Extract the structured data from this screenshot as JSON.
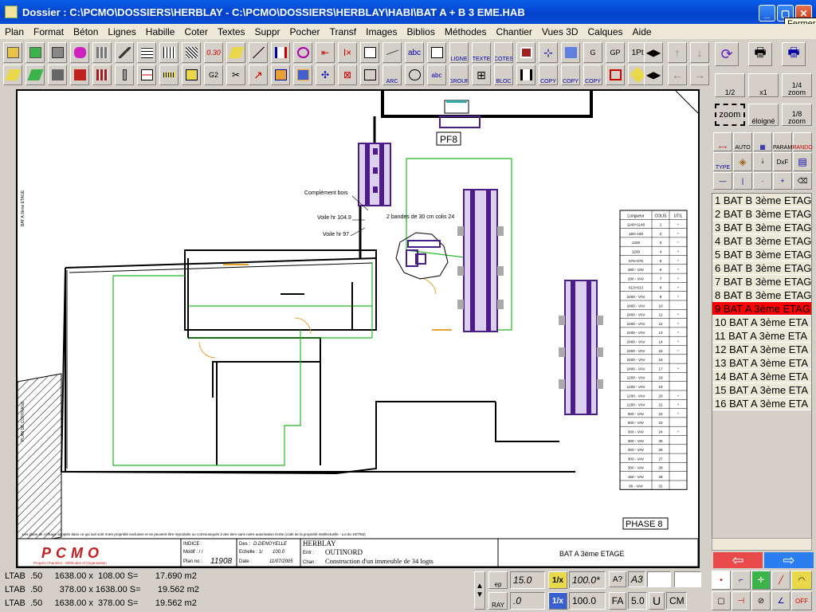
{
  "window": {
    "title": "Dossier : C:\\PCMO\\DOSSIERS\\HERBLAY - C:\\PCMO\\DOSSIERS\\HERBLAY\\HABI\\BAT A + B 3 EME.HAB",
    "tooltip": "Fermer"
  },
  "menu": [
    "Plan",
    "Format",
    "Béton",
    "Lignes",
    "Habille",
    "Coter",
    "Textes",
    "Suppr",
    "Pocher",
    "Transf",
    "Images",
    "Biblios",
    "Méthodes",
    "Chantier",
    "Vues 3D",
    "Calques",
    "Aide"
  ],
  "toolbar_labels": {
    "t030": "0.30",
    "ligne": "LIGNE",
    "texte": "TEXTE",
    "cotes": "COTES",
    "one_pt": "1Pt",
    "arc": "ARC",
    "group": "GROUP",
    "bloc": "BLOC",
    "copy1": "COPY",
    "copy2": "COPY",
    "copy3": "COPY",
    "g2": "G2",
    "gp": "GP",
    "abc": "abc"
  },
  "right_tools": {
    "half": "1/2",
    "x1": "x1",
    "quarter": "1/4",
    "zoom_lbl": "zoom",
    "zoom": "zoom",
    "eloigne": "éloigné",
    "eighth": "1/8",
    "auto": "AUTO",
    "param": "PARAM",
    "rando": "RANDO",
    "type": "TYPE",
    "dxf": "DxF",
    "dwg": "DWG",
    "abc": "abc"
  },
  "layers": [
    "1 BAT B 3ème ETAG",
    "2 BAT B 3ème ETAG",
    "3 BAT B 3ème ETAG",
    "4 BAT B 3ème ETAG",
    "5 BAT B 3ème ETAG",
    "6 BAT B 3ème ETAG",
    "7 BAT B 3ème ETAG",
    "8 BAT B 3ème ETAG",
    "9 BAT A 3ème ETAG",
    "10 BAT A 3ème ETA",
    "11 BAT A 3ème ETA",
    "12 BAT A 3ème ETA",
    "13 BAT A 3ème ETA",
    "14 BAT A 3ème ETA",
    "15 BAT A 3ème ETA",
    "16 BAT A 3ème ETA"
  ],
  "selected_layer_index": 8,
  "drawing": {
    "pf_label": "PF8",
    "annotations": {
      "complement": "Complément bois",
      "voile1": "Voile hr 104.9",
      "voile2": "Voile hr 97",
      "bandes": "2 bandes de 30 cm colis 24"
    },
    "phase": "PHASE 8",
    "table": {
      "headers": [
        "Longueur",
        "COLIS",
        "UTIL"
      ],
      "rows": [
        [
          "1140+1140",
          "1",
          "*"
        ],
        [
          "160+160",
          "2",
          "*"
        ],
        [
          "1200",
          "3",
          "*"
        ],
        [
          "1200",
          "4",
          "*"
        ],
        [
          "675+675",
          "5",
          "*"
        ],
        [
          "280 - VAV",
          "6",
          "*"
        ],
        [
          "280 - VAV",
          "7",
          "*"
        ],
        [
          "613+613",
          "8",
          "*"
        ],
        [
          "2400 - VAV",
          "9",
          "*"
        ],
        [
          "2400 - VAV",
          "10",
          ""
        ],
        [
          "2400 - VAV",
          "11",
          "*"
        ],
        [
          "2400 - VAV",
          "12",
          "*"
        ],
        [
          "2400 - VAV",
          "13",
          "*"
        ],
        [
          "2400 - VAV",
          "14",
          "*"
        ],
        [
          "2400 - VAV",
          "15",
          "*"
        ],
        [
          "2400 - VAV",
          "16",
          ""
        ],
        [
          "2400 - VAV",
          "17",
          "*"
        ],
        [
          "1200 - VAV",
          "18",
          ""
        ],
        [
          "1200 - VAV",
          "19",
          ""
        ],
        [
          "1200 - VAV",
          "20",
          "*"
        ],
        [
          "1200 - VAV",
          "21",
          "*"
        ],
        [
          "600 - VAV",
          "22",
          "*"
        ],
        [
          "600 - VAV",
          "23",
          ""
        ],
        [
          "300 - VAV",
          "24",
          "*"
        ],
        [
          "300 - VAV",
          "25",
          ""
        ],
        [
          "300 - VAV",
          "26",
          ""
        ],
        [
          "300 - VAV",
          "27",
          ""
        ],
        [
          "300 - VAV",
          "28",
          ""
        ],
        [
          "150 - VAV",
          "29",
          ""
        ],
        [
          "90 - VAV",
          "31",
          ""
        ]
      ]
    },
    "title_block": {
      "logo": "PCMO",
      "logo_sub": "Progrès Chantiers - Méthodes et Organisation",
      "indice_lbl": "INDICE :",
      "modif_lbl": "Modif : / /",
      "planno_lbl": "Plan no :",
      "planno": "11908",
      "des_lbl": "Des :",
      "des": "D.DENOYELLE",
      "echelle_lbl": "Echelle : 1/",
      "echelle": "100.0",
      "date_lbl": "Date :",
      "date": "11/07/2005",
      "project": "HERBLAY",
      "entr_lbl": "Entr :",
      "entr": "OUTINORD",
      "chan_lbl": "Chan :",
      "chan": "Construction d'un immeuble de 34 logts",
      "sheet": "BAT A 3ème ETAGE"
    },
    "footer_note": "Les plans de coffrage adoptés dans ce qui suit sont notre propriété exclusive et ne peuvent être reproduits ou communiqués à des tiers sans notre autorisation écrite (code de la propriété intellectuelle - Loi du 10/7/82)"
  },
  "status": {
    "lines": [
      "LTAB  .50     1638.00 x  108.00 S=       17.690 m2",
      "LTAB  .50       378.00 x 1638.00 S=       19.562 m2",
      "LTAB  .50     1638.00 x  378.00 S=       19.562 m2"
    ],
    "ep_lbl": "ep",
    "ep": "15.0",
    "ep2": ".0",
    "ray_lbl": "RAY",
    "onex": "1/x",
    "scale": "100.0*",
    "scale2": "100.0",
    "onex2": "1/x",
    "aq": "A?",
    "a3": "A3",
    "fa": "FA",
    "fa_val": "5.0",
    "u": "U",
    "cm": "CM"
  },
  "colors": {
    "title_bar": "#0a52d9",
    "selected_layer": "#ff0000",
    "arrow_red": "#e84a4a",
    "arrow_blue": "#2a7ef0",
    "formwork": "#4b1c8a",
    "green_lines": "#22b822"
  }
}
